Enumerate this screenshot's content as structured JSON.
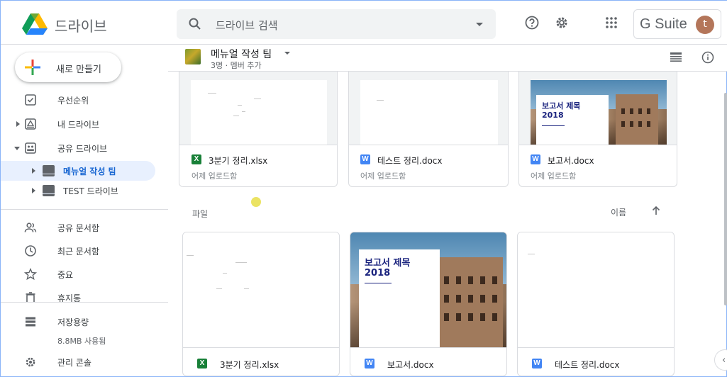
{
  "header": {
    "app_title": "드라이브",
    "search_placeholder": "드라이브 검색",
    "gsuite_label": "G Suite",
    "avatar_initial": "t"
  },
  "sidebar": {
    "new_button": "새로 만들기",
    "items": [
      {
        "label": "우선순위",
        "icon": "check-box-icon"
      },
      {
        "label": "내 드라이브",
        "icon": "my-drive-icon"
      },
      {
        "label": "공유 드라이브",
        "icon": "shared-drive-icon"
      }
    ],
    "shared_drives": [
      {
        "label": "메뉴얼 작성 팀",
        "active": true
      },
      {
        "label": "TEST 드라이브",
        "active": false
      }
    ],
    "secondary": [
      {
        "label": "공유 문서함",
        "icon": "people-icon"
      },
      {
        "label": "최근 문서함",
        "icon": "clock-icon"
      },
      {
        "label": "중요",
        "icon": "star-icon"
      },
      {
        "label": "휴지통",
        "icon": "trash-icon"
      }
    ],
    "storage": {
      "label": "저장용량",
      "usage": "8.8MB 사용됨"
    },
    "admin": {
      "label": "관리 콘솔"
    }
  },
  "main": {
    "team_name": "메뉴얼 작성 팀",
    "team_meta": "3명 · 멤버 추가",
    "quick_access": [
      {
        "name": "3분기 정리.xlsx",
        "type": "X",
        "sub": "어제 업로드함",
        "preview": "sheet"
      },
      {
        "name": "테스트 정리.docx",
        "type": "W",
        "sub": "어제 업로드함",
        "preview": "doc"
      },
      {
        "name": "보고서.docx",
        "type": "W",
        "sub": "어제 업로드함",
        "preview": "report"
      }
    ],
    "files_section_label": "파일",
    "sort_label": "이름",
    "files": [
      {
        "name": "3분기 정리.xlsx",
        "type": "X",
        "preview": "sheet"
      },
      {
        "name": "보고서.docx",
        "type": "W",
        "preview": "report"
      },
      {
        "name": "테스트 정리.docx",
        "type": "W",
        "preview": "doc"
      }
    ],
    "report_preview": {
      "title_line1": "보고서 제목",
      "title_line2": "2018"
    }
  },
  "colors": {
    "accent_blue": "#1967d2",
    "active_bg": "#e8f0fe",
    "xlsx_green": "#188038",
    "docx_blue": "#4285f4",
    "avatar_brown": "#b4765a"
  }
}
